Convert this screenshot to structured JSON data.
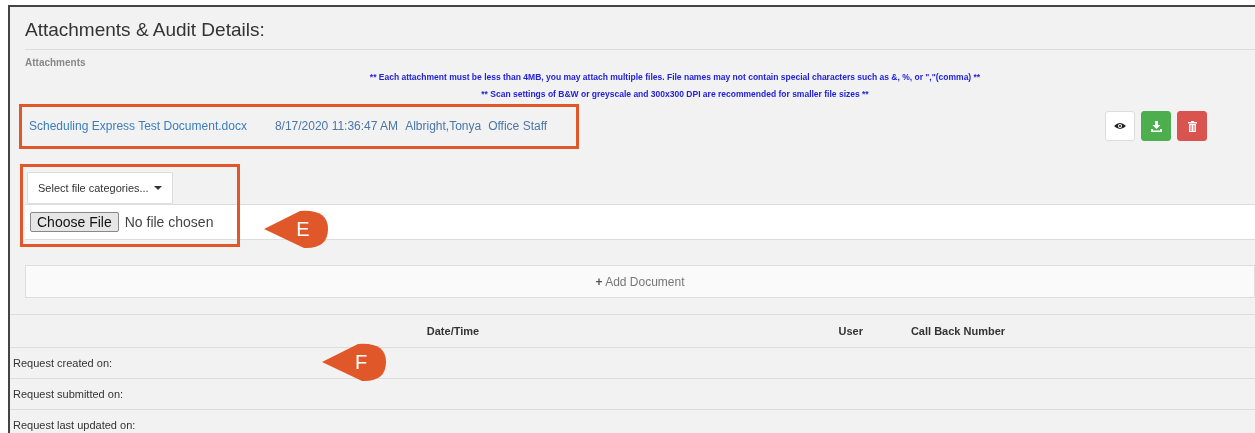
{
  "section": {
    "title": "Attachments & Audit Details:"
  },
  "attachments": {
    "heading": "Attachments",
    "notices": [
      "** Each attachment must be less than 4MB, you may attach multiple files. File names may not contain special characters such as &, %, or \",\"(comma) **",
      "** Scan settings of B&W or greyscale and 300x300 DPI are recommended for smaller file sizes **"
    ],
    "files": [
      {
        "name": "Scheduling Express Test Document.docx",
        "datetime": "8/17/2020 11:36:47 AM",
        "user": "Albright,Tonya",
        "role": "Office Staff",
        "highlighted": true
      }
    ],
    "category_select": {
      "label": "Select file categories..."
    },
    "file_input": {
      "button": "Choose File",
      "status": "No file chosen"
    },
    "add_button": {
      "icon": "+",
      "label": "Add Document"
    }
  },
  "audit": {
    "columns": [
      "Date/Time",
      "User",
      "Call Back Number"
    ],
    "rows": [
      {
        "label": "Request created on:"
      },
      {
        "label": "Request submitted on:"
      },
      {
        "label": "Request last updated on:"
      }
    ]
  },
  "callouts": [
    {
      "label": "E"
    },
    {
      "label": "F"
    }
  ]
}
